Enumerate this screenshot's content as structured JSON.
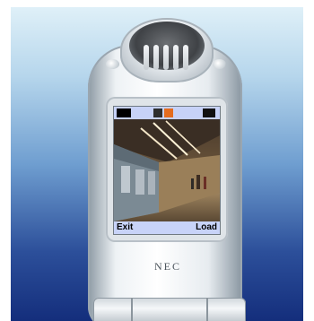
{
  "phone": {
    "brand": "NEC",
    "softkeys": {
      "left": "Exit",
      "right": "Load"
    }
  },
  "colors": {
    "background_top": "#dff0f8",
    "background_bottom": "#142e7c",
    "screen_bar": "#c8d3f8"
  }
}
